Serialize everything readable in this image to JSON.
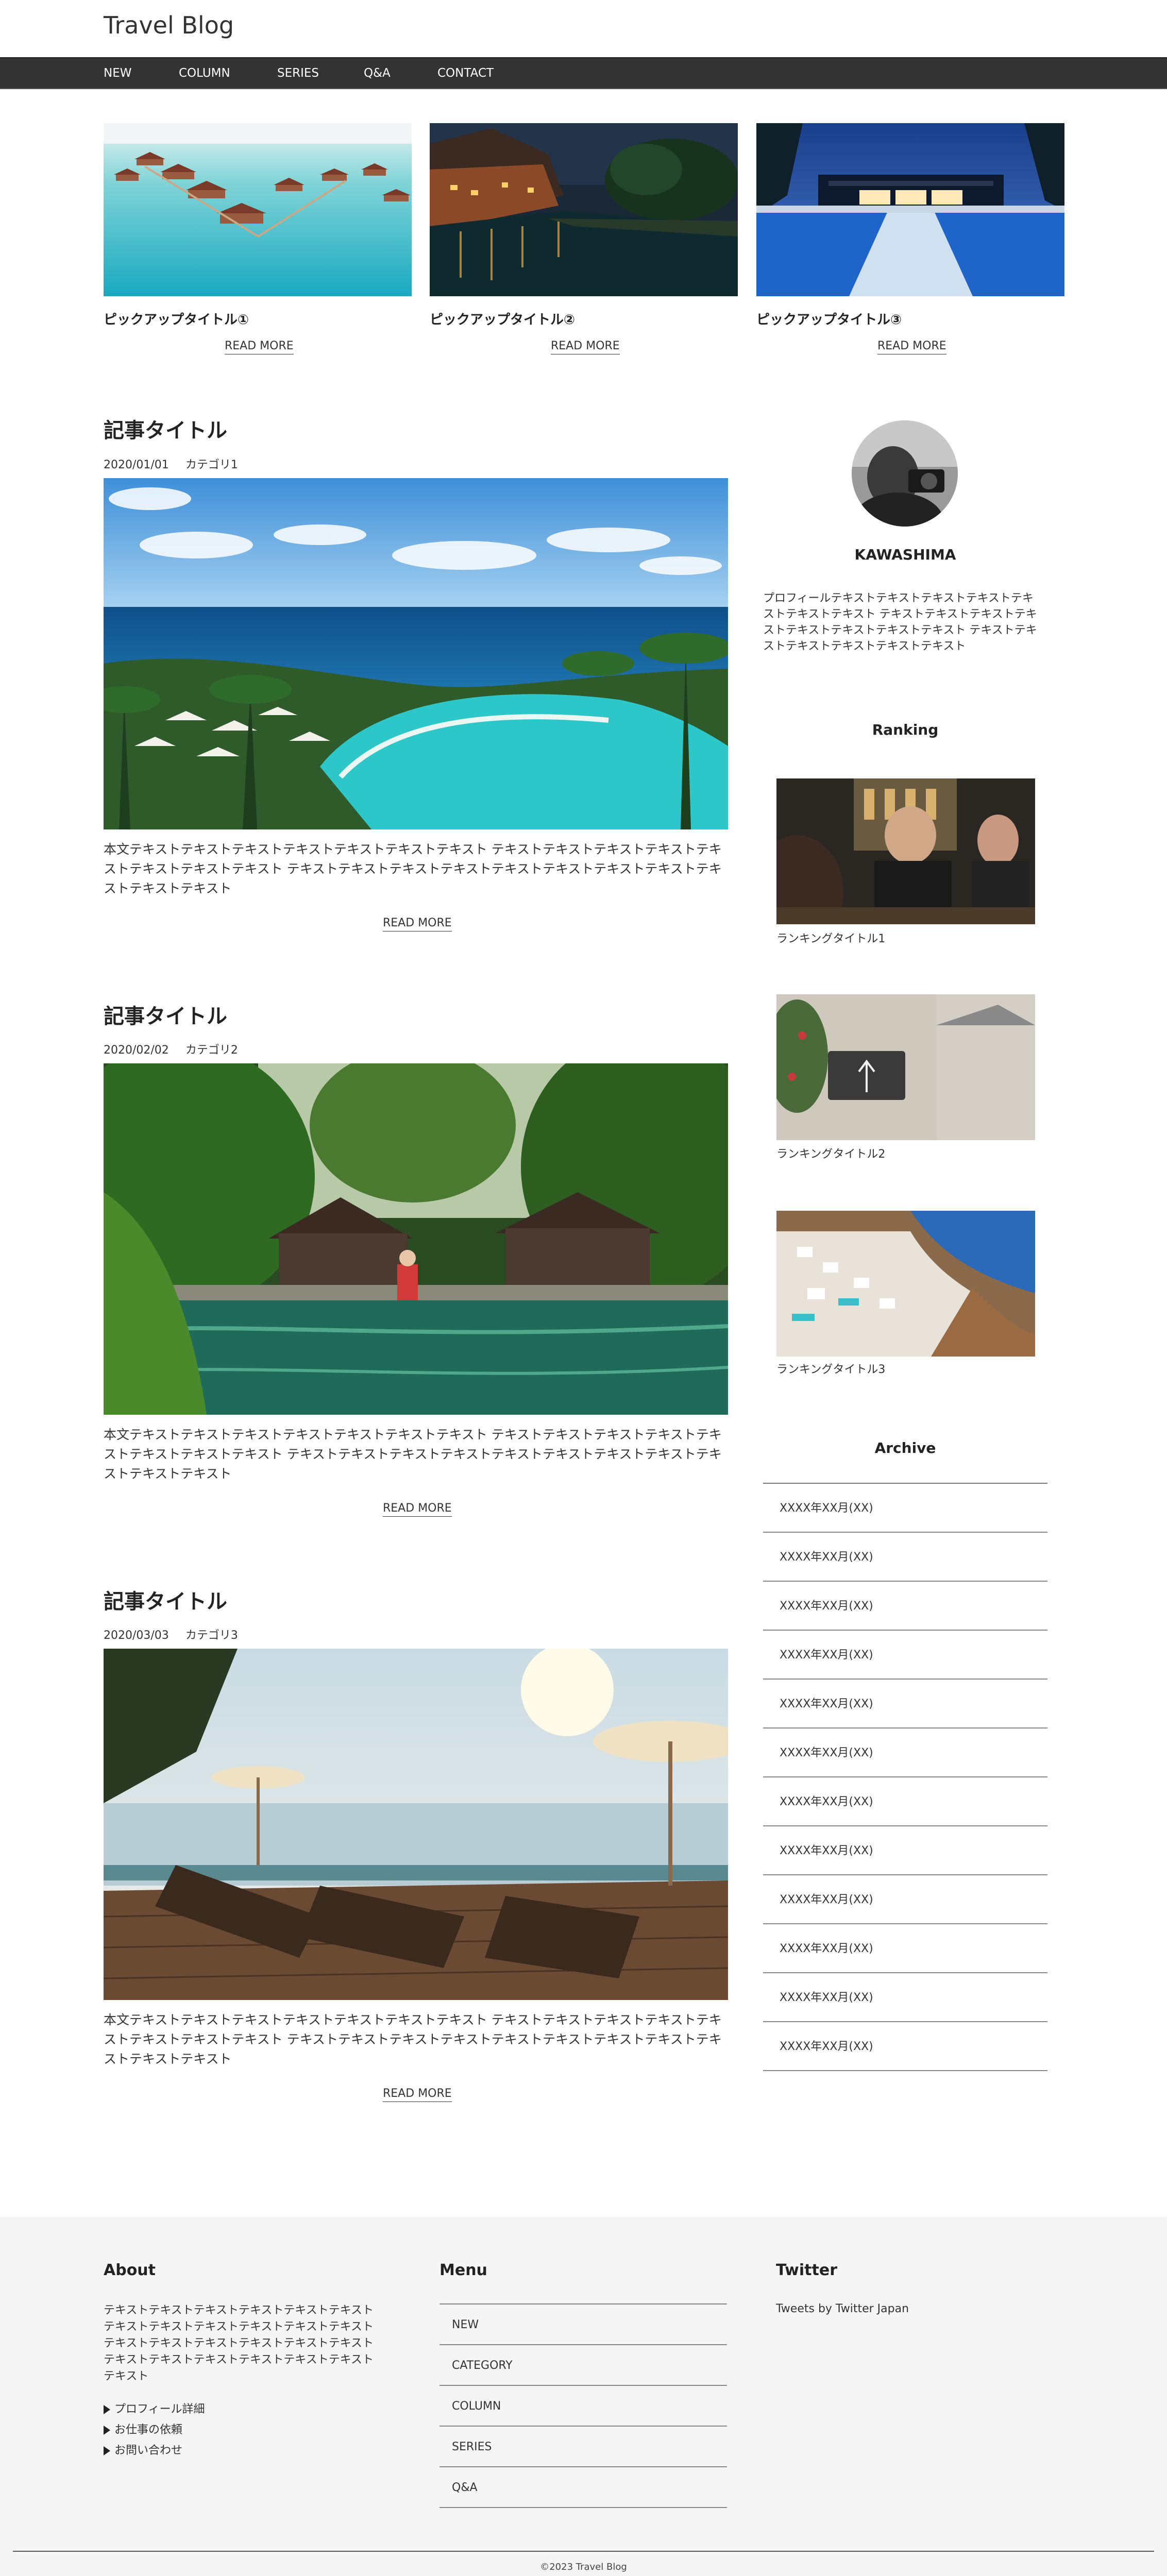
{
  "header": {
    "title": "Travel Blog"
  },
  "nav": [
    "NEW",
    "COLUMN",
    "SERIES",
    "Q&A",
    "CONTACT"
  ],
  "pickups": [
    {
      "title": "ピックアップタイトル①",
      "readmore": "READ MORE"
    },
    {
      "title": "ピックアップタイトル②",
      "readmore": "READ MORE"
    },
    {
      "title": "ピックアップタイトル③",
      "readmore": "READ MORE"
    }
  ],
  "articles": [
    {
      "title": "記事タイトル",
      "date": "2020/01/01",
      "category": "カテゴリ1",
      "body": "本文テキストテキストテキストテキストテキストテキストテキスト テキストテキストテキストテキストテキストテキストテキストテキスト テキストテキストテキストテキストテキストテキストテキストテキストテキストテキストテキスト",
      "readmore": "READ MORE"
    },
    {
      "title": "記事タイトル",
      "date": "2020/02/02",
      "category": "カテゴリ2",
      "body": "本文テキストテキストテキストテキストテキストテキストテキスト テキストテキストテキストテキストテキストテキストテキストテキスト テキストテキストテキストテキストテキストテキストテキストテキストテキストテキストテキスト",
      "readmore": "READ MORE"
    },
    {
      "title": "記事タイトル",
      "date": "2020/03/03",
      "category": "カテゴリ3",
      "body": "本文テキストテキストテキストテキストテキストテキストテキスト テキストテキストテキストテキストテキストテキストテキストテキスト テキストテキストテキストテキストテキストテキストテキストテキストテキストテキストテキスト",
      "readmore": "READ MORE"
    }
  ],
  "sidebar": {
    "profile": {
      "name": "KAWASHIMA",
      "text": "プロフィールテキストテキストテキストテキストテキストテキストテキスト テキストテキストテキストテキストテキストテキストテキストテキスト テキストテキストテキストテキストテキストテキスト"
    },
    "ranking": {
      "heading": "Ranking",
      "items": [
        "ランキングタイトル1",
        "ランキングタイトル2",
        "ランキングタイトル3"
      ]
    },
    "archive": {
      "heading": "Archive",
      "items": [
        "XXXX年XX月(XX)",
        "XXXX年XX月(XX)",
        "XXXX年XX月(XX)",
        "XXXX年XX月(XX)",
        "XXXX年XX月(XX)",
        "XXXX年XX月(XX)",
        "XXXX年XX月(XX)",
        "XXXX年XX月(XX)",
        "XXXX年XX月(XX)",
        "XXXX年XX月(XX)",
        "XXXX年XX月(XX)",
        "XXXX年XX月(XX)"
      ]
    }
  },
  "footer": {
    "about": {
      "heading": "About",
      "text": "テキストテキストテキストテキストテキストテキストテキストテキストテキストテキストテキストテキストテキストテキストテキストテキストテキストテキストテキストテキストテキストテキストテキストテキストテキスト",
      "links": [
        "プロフィール詳細",
        "お仕事の依頼",
        "お問い合わせ"
      ]
    },
    "menu": {
      "heading": "Menu",
      "items": [
        "NEW",
        "CATEGORY",
        "COLUMN",
        "SERIES",
        "Q&A"
      ]
    },
    "twitter": {
      "heading": "Twitter",
      "text": "Tweets by Twitter Japan"
    },
    "copyright": "©2023 Travel Blog"
  },
  "colors": {
    "nav_bg": "#333333",
    "footer_bg": "#f5f5f5",
    "text": "#333333"
  }
}
